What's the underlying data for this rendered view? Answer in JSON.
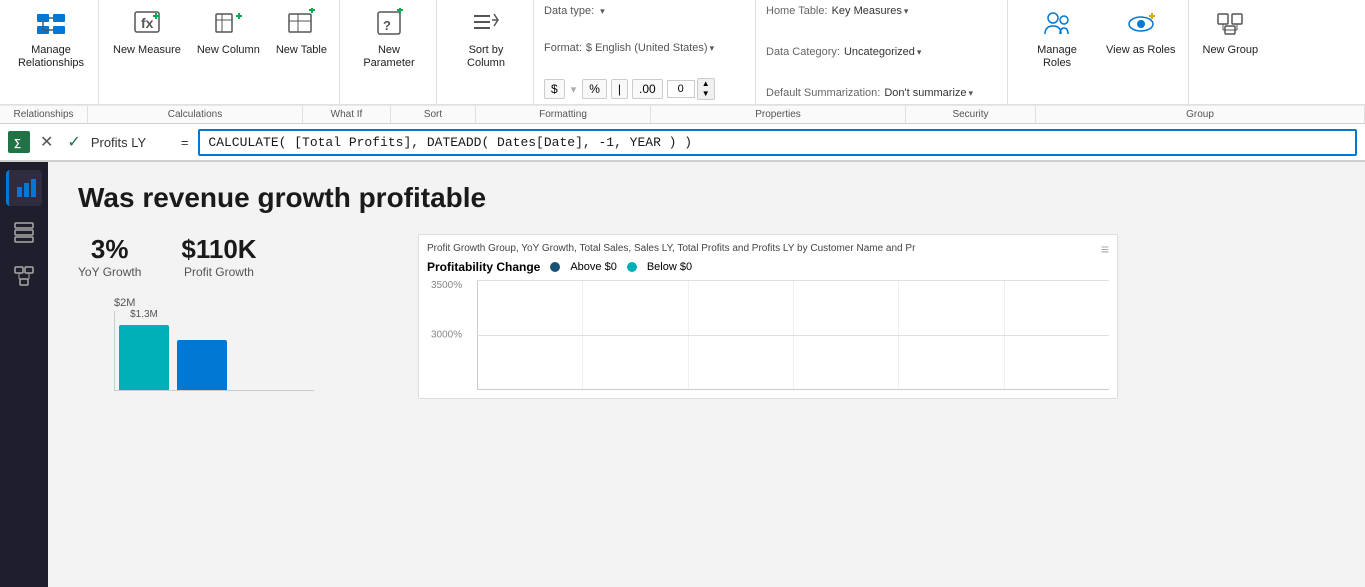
{
  "ribbon": {
    "relationships_label": "Manage\nRelationships",
    "new_measure_label": "New\nMeasure",
    "new_column_label": "New\nColumn",
    "new_table_label": "New\nTable",
    "new_parameter_label": "New\nParameter",
    "sort_by_column_label": "Sort by\nColumn",
    "manage_roles_label": "Manage\nRoles",
    "view_as_roles_label": "View as\nRoles",
    "new_group_label": "New\nGroup",
    "section_relationships": "Relationships",
    "section_calculations": "Calculations",
    "section_whatif": "What If",
    "section_sort": "Sort",
    "section_formatting": "Formatting",
    "section_properties": "Properties",
    "section_security": "Security",
    "section_group": "Group",
    "dtype_label": "Data type:",
    "dtype_value": "",
    "format_label": "Format:",
    "format_value": "$ English (United States)",
    "format_caret": "▾",
    "currency_symbol": "$",
    "pct_symbol": "%",
    "separator_symbol": "|",
    "decimal_symbol": ".00",
    "spin_value": "0",
    "home_table_label": "Home Table:",
    "home_table_value": "Key Measures",
    "data_category_label": "Data Category:",
    "data_category_value": "Uncategorized",
    "default_summarization_label": "Default Summarization:",
    "default_summarization_value": "Don't summarize"
  },
  "formula_bar": {
    "cancel_icon": "✕",
    "confirm_icon": "✓",
    "measure_name": "Profits LY",
    "equals": "=",
    "formula": "CALCULATE( [Total Profits], DATEADD( Dates[Date], -1, YEAR ) )"
  },
  "sidebar": {
    "icon_report": "📊",
    "icon_data": "⊞",
    "icon_model": "⊟"
  },
  "canvas": {
    "page_title": "Was revenue growth profitable",
    "metric1_value": "3%",
    "metric1_label": "YoY Growth",
    "metric2_value": "$110K",
    "metric2_label": "Profit Growth",
    "y_axis_label": "$2M",
    "bar1_height": "80",
    "bar1_label": "$1.3M",
    "bar1_color": "#00b0b9",
    "right_panel_title": "Profit Growth Group, YoY Growth, Total Sales, Sales LY, Total Profits and Profits LY by Customer Name and Pr",
    "profitability_label": "Profitability Change",
    "legend_above": "Above $0",
    "legend_below": "Below $0",
    "legend_above_color": "#1a5276",
    "legend_below_color": "#00b0b9",
    "y_label_3500": "3500%",
    "y_label_3000": "3000%"
  }
}
